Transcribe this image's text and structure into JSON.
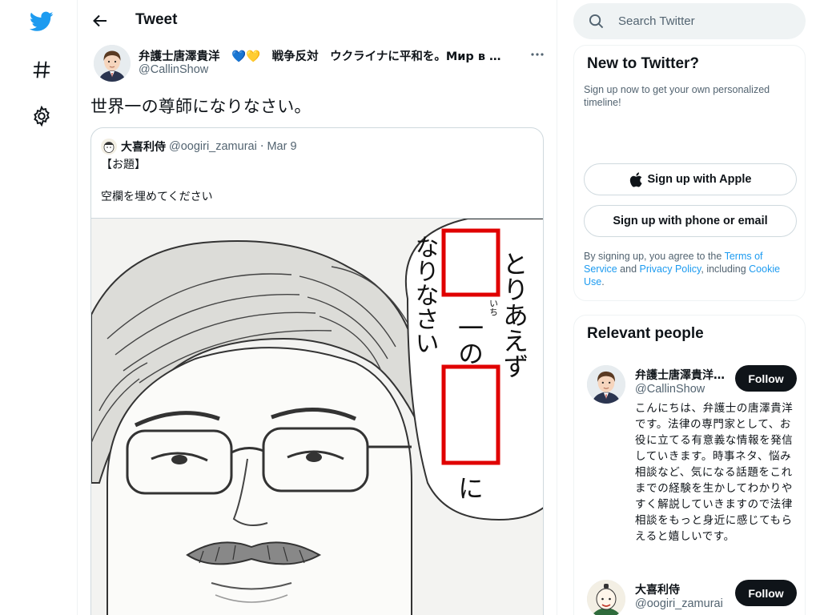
{
  "nav": {
    "items": [
      {
        "name": "twitter-logo-icon"
      },
      {
        "name": "explore-hashtag-icon"
      },
      {
        "name": "settings-gear-icon"
      }
    ],
    "brand_color": "#1d9bf0"
  },
  "header": {
    "title": "Tweet"
  },
  "tweet": {
    "author_name": "弁護士唐澤貴洋　💙💛　戦争反対　ウクライナに平和を。Мир в …",
    "author_handle": "@CallinShow",
    "text": "世界一の尊師になりなさい。",
    "quote": {
      "author_name": "大喜利侍",
      "author_handle": "@oogiri_zamurai",
      "separator": "·",
      "date": "Mar 9",
      "line1": "【お題】",
      "line2": "空欄を埋めてください",
      "image_text": {
        "right_col": "とりあえず",
        "mid_col": "一の",
        "ruby": "いち",
        "end": "に",
        "left_col": "なりなさい"
      }
    }
  },
  "search": {
    "placeholder": "Search Twitter"
  },
  "new_to_twitter": {
    "title": "New to Twitter?",
    "subtitle": "Sign up now to get your own personalized timeline!",
    "apple_button": "Sign up with Apple",
    "phone_button": "Sign up with phone or email",
    "terms_prefix": "By signing up, you agree to the ",
    "terms_link": "Terms of Service",
    "terms_and": " and ",
    "privacy_link": "Privacy Policy",
    "terms_including": ", including ",
    "cookie_link": "Cookie Use",
    "terms_end": "."
  },
  "relevant_people": {
    "title": "Relevant people",
    "people": [
      {
        "name": "弁護士唐澤貴洋　💙💛",
        "handle": "@CallinShow",
        "follow_label": "Follow",
        "bio": "こんにちは、弁護士の唐澤貴洋です。法律の専門家として、お役に立てる有意義な情報を発信していきます。時事ネタ、悩み相談など、気になる話題をこれまでの経験を生かしてわかりやすく解説していきますので法律相談をもっと身近に感じてもらえると嬉しいです。"
      },
      {
        "name": "大喜利侍",
        "handle": "@oogiri_zamurai",
        "follow_label": "Follow"
      }
    ]
  }
}
